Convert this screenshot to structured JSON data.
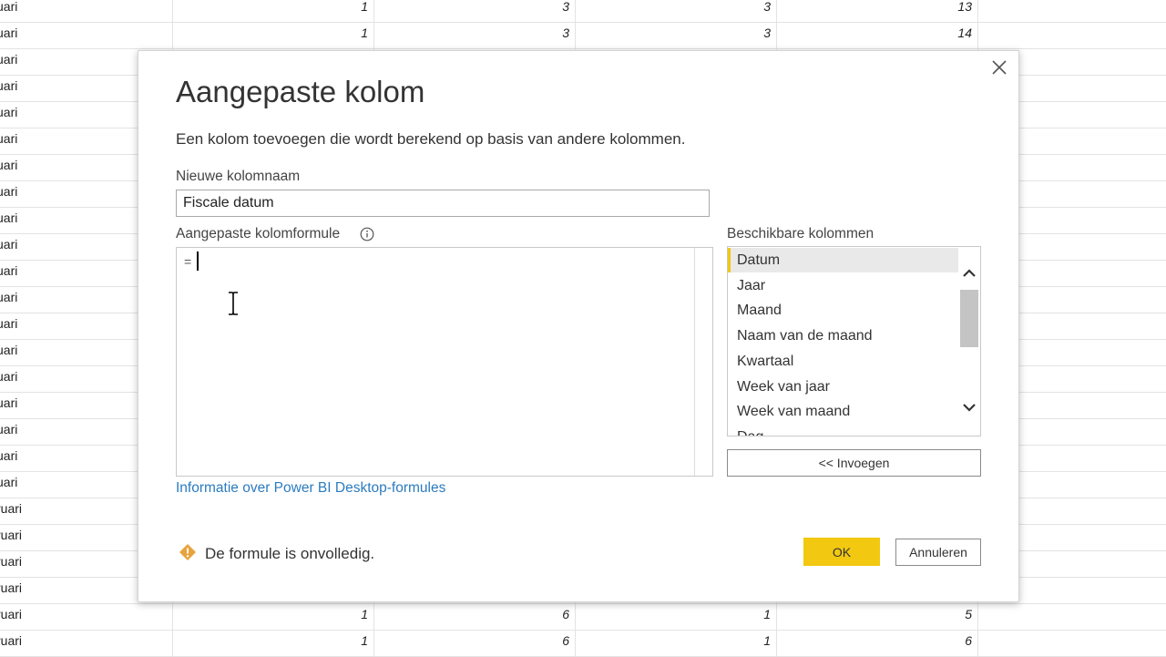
{
  "background_table": {
    "rows": [
      {
        "name": "uari",
        "values": [
          "1",
          "3",
          "3",
          "13"
        ]
      },
      {
        "name": "uari",
        "values": [
          "1",
          "3",
          "3",
          "14"
        ]
      },
      {
        "name": "uari",
        "values": []
      },
      {
        "name": "uari",
        "values": []
      },
      {
        "name": "uari",
        "values": []
      },
      {
        "name": "uari",
        "values": []
      },
      {
        "name": "uari",
        "values": []
      },
      {
        "name": "uari",
        "values": []
      },
      {
        "name": "uari",
        "values": []
      },
      {
        "name": "uari",
        "values": []
      },
      {
        "name": "uari",
        "values": []
      },
      {
        "name": "uari",
        "values": []
      },
      {
        "name": "uari",
        "values": []
      },
      {
        "name": "uari",
        "values": []
      },
      {
        "name": "uari",
        "values": []
      },
      {
        "name": "uari",
        "values": []
      },
      {
        "name": "uari",
        "values": []
      },
      {
        "name": "uari",
        "values": []
      },
      {
        "name": "uari",
        "values": []
      },
      {
        "name": "ruari",
        "values": []
      },
      {
        "name": "ruari",
        "values": []
      },
      {
        "name": "ruari",
        "values": []
      },
      {
        "name": "ruari",
        "values": []
      },
      {
        "name": "ruari",
        "values": [
          "1",
          "6",
          "1",
          "5"
        ]
      },
      {
        "name": "ruari",
        "values": [
          "1",
          "6",
          "1",
          "6"
        ]
      }
    ]
  },
  "dialog": {
    "title": "Aangepaste kolom",
    "description": "Een kolom toevoegen die wordt berekend op basis van andere kolommen.",
    "new_column_label": "Nieuwe kolomnaam",
    "new_column_value": "Fiscale datum",
    "formula_label": "Aangepaste kolomformule",
    "formula_prefix": "=",
    "help_link": "Informatie over Power BI Desktop-formules",
    "available_columns_label": "Beschikbare kolommen",
    "available_columns": [
      "Datum",
      "Jaar",
      "Maand",
      "Naam van de maand",
      "Kwartaal",
      "Week van jaar",
      "Week van maand",
      "Dag"
    ],
    "selected_column": "Datum",
    "insert_button": "<< Invoegen",
    "warning_text": "De formule is onvolledig.",
    "ok_button": "OK",
    "cancel_button": "Annuleren"
  },
  "colors": {
    "accent": "#f2c811",
    "link": "#2b7bbf",
    "warning": "#e8a33d"
  }
}
